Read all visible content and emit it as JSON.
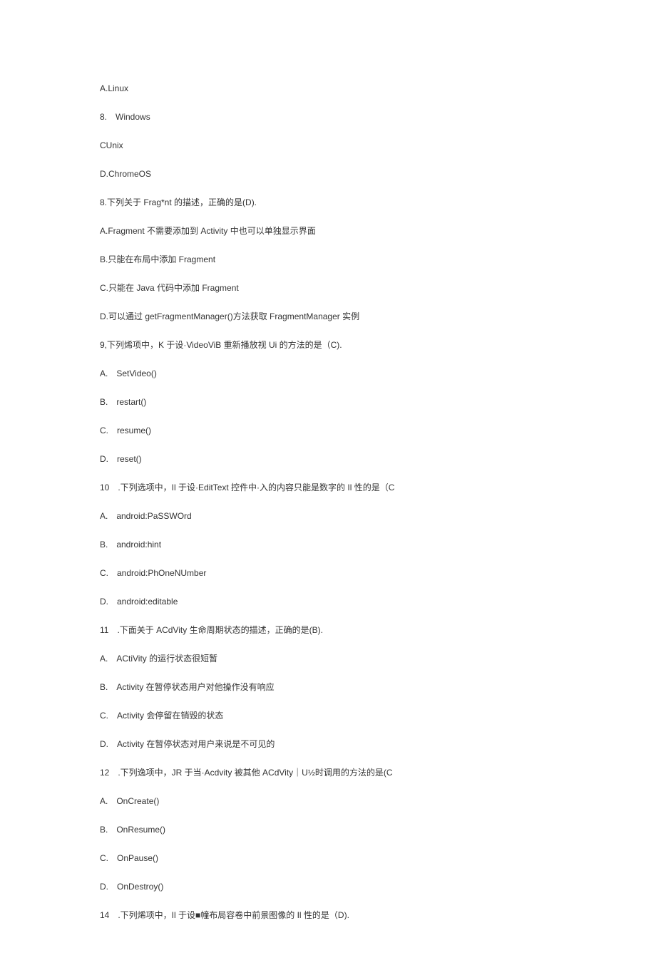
{
  "lines": [
    {
      "text": "A.Linux",
      "indent": false
    },
    {
      "text": "8.　Windows",
      "indent": false
    },
    {
      "text": "CUnix",
      "indent": false
    },
    {
      "text": "D.ChromeOS",
      "indent": false
    },
    {
      "text": "8.下列关于 Frag*nt 的描述，正确的是(D).",
      "indent": false
    },
    {
      "text": "A.Fragment 不需要添加到 Activity 中也可以单独显示界面",
      "indent": false
    },
    {
      "text": "B.只能在布局中添加 Fragment",
      "indent": false
    },
    {
      "text": "C.只能在 Java 代码中添加 Fragment",
      "indent": false
    },
    {
      "text": "D.可以通过 getFragmentManager()方法获取 FragmentManager 实例",
      "indent": false
    },
    {
      "text": "9,下列烯项中，K 于设·VideoViB 重新播放视 Ui 的方法的是（C).",
      "indent": false
    },
    {
      "text": "A.　SetVideo()",
      "indent": true
    },
    {
      "text": "B.　restart()",
      "indent": true
    },
    {
      "text": "C.　resume()",
      "indent": true
    },
    {
      "text": "D.　reset()",
      "indent": true
    },
    {
      "text": "10　.下列选项中，Il 于设·EditText 控件中·入的内容只能是数字的 Il 性的是（C",
      "indent": true
    },
    {
      "text": "A.　android:PaSSWOrd",
      "indent": true
    },
    {
      "text": "B.　android:hint",
      "indent": true
    },
    {
      "text": "C.　android:PhOneNUmber",
      "indent": true
    },
    {
      "text": "D.　android:editable",
      "indent": true
    },
    {
      "text": "11　.下面关于 ACdVity 生命周期状态的描述，正确的是(B).",
      "indent": true
    },
    {
      "text": "A.　ACtiVity 的运行状态很短暂",
      "indent": true
    },
    {
      "text": "B.　Activity 在暂停状态用户对他操作没有响应",
      "indent": true
    },
    {
      "text": "C.　Activity 会停留在销毁的状态",
      "indent": true
    },
    {
      "text": "D.　Activity 在暂停状态对用户来说是不可见的",
      "indent": true
    },
    {
      "text": "12　.下列逸项中，JR 于当·Acdvity 被其他 ACdVity｜U½时调用的方法的是(C",
      "indent": true
    },
    {
      "text": "A.　OnCreate()",
      "indent": true
    },
    {
      "text": "B.　OnResume()",
      "indent": true
    },
    {
      "text": "C.　OnPause()",
      "indent": true
    },
    {
      "text": "D.　OnDestroy()",
      "indent": true
    },
    {
      "text": "14　.下列烯项中，Il 于设■幢布局容卷中前景图像的 Il 性的是（D).",
      "indent": true
    }
  ]
}
